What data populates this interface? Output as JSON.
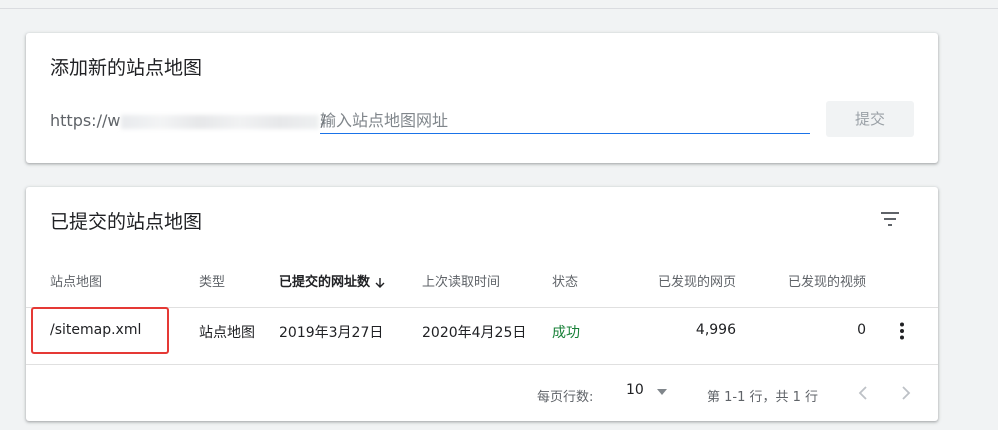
{
  "add_card": {
    "title": "添加新的站点地图",
    "url_prefix_start": "https://w",
    "url_prefix_end": "/",
    "input_placeholder": "输入站点地图网址",
    "input_value": "",
    "submit_label": "提交"
  },
  "submitted_card": {
    "title": "已提交的站点地图",
    "columns": {
      "sitemap": "站点地图",
      "type": "类型",
      "submitted_urls": "已提交的网址数",
      "last_read": "上次读取时间",
      "status": "状态",
      "discovered_pages": "已发现的网页",
      "discovered_videos": "已发现的视频"
    },
    "rows": [
      {
        "sitemap": "/sitemap.xml",
        "type": "站点地图",
        "submitted": "2019年3月27日",
        "last_read": "2020年4月25日",
        "status": "成功",
        "pages": "4,996",
        "videos": "0"
      }
    ],
    "footer": {
      "rows_per_page_label": "每页行数:",
      "rows_per_page_value": "10",
      "range_text": "第 1-1 行，共 1 行"
    }
  },
  "icons": {
    "filter": "filter-icon",
    "sort": "arrow-down-icon",
    "more": "more-vert-icon",
    "dropdown": "triangle-down-icon",
    "prev": "chevron-left-icon",
    "next": "chevron-right-icon"
  },
  "colors": {
    "accent": "#1a73e8",
    "status_success": "#188038",
    "highlight": "#e53935"
  }
}
